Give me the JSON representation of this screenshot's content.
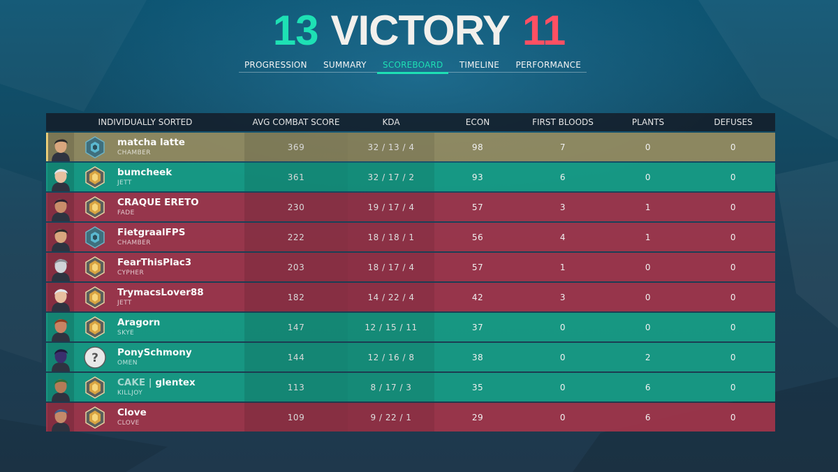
{
  "header": {
    "score_left": "13",
    "result": "VICTORY",
    "score_right": "11"
  },
  "tabs": [
    {
      "label": "PROGRESSION",
      "active": false
    },
    {
      "label": "SUMMARY",
      "active": false
    },
    {
      "label": "SCOREBOARD",
      "active": true
    },
    {
      "label": "TIMELINE",
      "active": false
    },
    {
      "label": "PERFORMANCE",
      "active": false
    }
  ],
  "table": {
    "headers": {
      "player": "INDIVIDUALLY SORTED",
      "acs": "AVG COMBAT SCORE",
      "kda": "KDA",
      "econ": "ECON",
      "first_bloods": "FIRST BLOODS",
      "plants": "PLANTS",
      "defuses": "DEFUSES"
    },
    "rows": [
      {
        "name": "matcha latte",
        "agent": "CHAMBER",
        "acs": "369",
        "kda": "32 / 13 / 4",
        "econ": "98",
        "first_bloods": "7",
        "plants": "0",
        "defuses": "0",
        "team": "self",
        "rank_icon": "iron-rank-icon"
      },
      {
        "name": "bumcheek",
        "agent": "JETT",
        "acs": "361",
        "kda": "32 / 17 / 2",
        "econ": "93",
        "first_bloods": "6",
        "plants": "0",
        "defuses": "0",
        "team": "ally",
        "rank_icon": "gold-rank-icon"
      },
      {
        "name": "CRAQUE ERETO",
        "agent": "FADE",
        "acs": "230",
        "kda": "19 / 17 / 4",
        "econ": "57",
        "first_bloods": "3",
        "plants": "1",
        "defuses": "0",
        "team": "enemy",
        "rank_icon": "gold-rank-icon"
      },
      {
        "name": "FietgraalFPS",
        "agent": "CHAMBER",
        "acs": "222",
        "kda": "18 / 18 / 1",
        "econ": "56",
        "first_bloods": "4",
        "plants": "1",
        "defuses": "0",
        "team": "enemy",
        "rank_icon": "iron-rank-icon"
      },
      {
        "name": "FearThisPlac3",
        "agent": "CYPHER",
        "acs": "203",
        "kda": "18 / 17 / 4",
        "econ": "57",
        "first_bloods": "1",
        "plants": "0",
        "defuses": "0",
        "team": "enemy",
        "rank_icon": "gold-rank-icon"
      },
      {
        "name": "TrymacsLover88",
        "agent": "JETT",
        "acs": "182",
        "kda": "14 / 22 / 4",
        "econ": "42",
        "first_bloods": "3",
        "plants": "0",
        "defuses": "0",
        "team": "enemy",
        "rank_icon": "gold-rank-icon"
      },
      {
        "name": "Aragorn",
        "agent": "SKYE",
        "acs": "147",
        "kda": "12 / 15 / 11",
        "econ": "37",
        "first_bloods": "0",
        "plants": "0",
        "defuses": "0",
        "team": "ally",
        "rank_icon": "gold-rank-icon"
      },
      {
        "name": "PonySchmony",
        "agent": "OMEN",
        "acs": "144",
        "kda": "12 / 16 / 8",
        "econ": "38",
        "first_bloods": "0",
        "plants": "2",
        "defuses": "0",
        "team": "ally",
        "rank_icon": "unranked-icon"
      },
      {
        "name_tag": "CAKE",
        "name": "glentex",
        "agent": "KILLJOY",
        "acs": "113",
        "kda": "8 / 17 / 3",
        "econ": "35",
        "first_bloods": "0",
        "plants": "6",
        "defuses": "0",
        "team": "ally",
        "rank_icon": "gold-rank-icon"
      },
      {
        "name": "Clove",
        "agent": "CLOVE",
        "acs": "109",
        "kda": "9 / 22 / 1",
        "econ": "29",
        "first_bloods": "0",
        "plants": "6",
        "defuses": "0",
        "team": "enemy",
        "rank_icon": "gold-rank-icon"
      }
    ]
  },
  "colors": {
    "ally": "#1ee0b4",
    "enemy": "#ff5063",
    "self_row": "#9d8f60",
    "ally_row": "#179e87",
    "enemy_row": "#a8344a"
  }
}
